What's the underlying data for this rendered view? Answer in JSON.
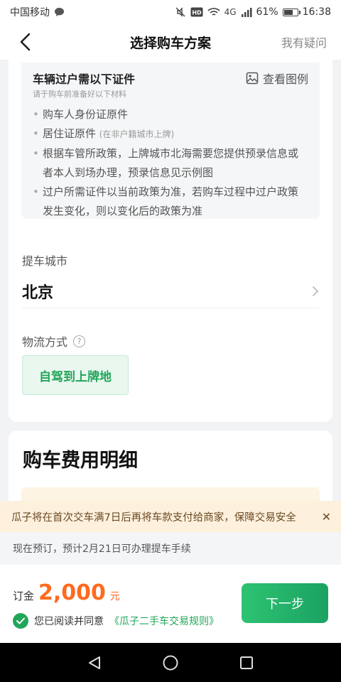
{
  "status_bar": {
    "carrier": "中国移动",
    "network": "4G",
    "battery": "61%",
    "time": "16:38"
  },
  "nav": {
    "title": "选择购车方案",
    "help": "我有疑问"
  },
  "documents": {
    "title": "车辆过户需以下证件",
    "subtitle": "请于购车前准备好以下材料",
    "view_example": "查看图例",
    "items": [
      {
        "text": "购车人身份证原件",
        "note": ""
      },
      {
        "text": "居住证原件",
        "note": "(在非户籍城市上牌)"
      },
      {
        "text": "根据车管所政策，上牌城市北海需要您提供预录信息或者本人到场办理，预录信息见示例图",
        "note": ""
      },
      {
        "text": "过户所需证件以当前政策为准，若购车过程中过户政策发生变化，则以变化后的政策为准",
        "note": ""
      }
    ]
  },
  "pickup": {
    "label": "提车城市",
    "city": "北京"
  },
  "logistics": {
    "label": "物流方式",
    "option": "自驾到上牌地"
  },
  "fees": {
    "title": "购车费用明细"
  },
  "banner": {
    "text": "瓜子将在首次交车满7日后再将车款支付给商家，保障交易安全"
  },
  "notice": {
    "text": "现在预订，预计2月21日可办理提车手续"
  },
  "bottom": {
    "deposit_label": "订金",
    "deposit_amount": "2,000",
    "deposit_unit": "元",
    "agree_text": "您已阅读并同意",
    "agree_link": "《瓜子二手车交易规则》",
    "next_button": "下一步"
  },
  "colors": {
    "accent_green": "#23a55a",
    "price_orange": "#ff6a1f",
    "banner_bg": "#fdf0dd"
  }
}
